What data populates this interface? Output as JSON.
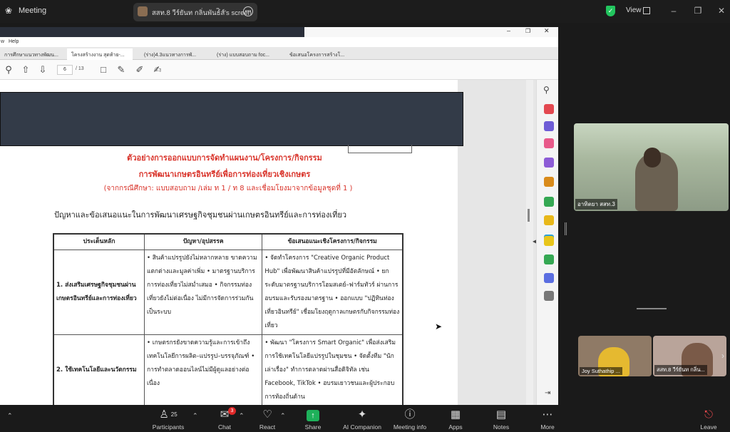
{
  "titlebar": {
    "app_name": "Meeting",
    "share_tab": "สสท.8 วีร์ยันท กลิ่นพันธ์ิส์'s screen",
    "view_label": "View"
  },
  "document": {
    "menu_items": [
      "w",
      "Help"
    ],
    "tabs": [
      "การศึกษาแนวทางพัฒน...",
      "โครงสร้างงาน สุดท้าย-...",
      "(ร่าง)4.3แนวทางการพั...",
      "(ร่าง) แบบสอบถาม foc...",
      "ข้อเสนอโครงการสร้างโ..."
    ],
    "active_tab_index": 1,
    "page_current": "6",
    "page_total": "/ 13",
    "title_line1": "ตัวอย่างการออกแบบการจัดทำแผนงาน/โครงการ/กิจกรรม",
    "title_line2": "การพัฒนาเกษตรอินทรีย์เพื่อการท่องเที่ยวเชิงเกษตร",
    "title_line3": "(จากกรณีศึกษา: แบบสอบถาม /เล่ม ท 1 / ท 8 และเชื่อมโยงมาจากข้อมูลชุดที่ 1 )",
    "heading": "ปัญหาและข้อเสนอแนะในการพัฒนาเศรษฐกิจชุมชนผ่านเกษตรอินทรีย์และการท่องเที่ยว",
    "table": {
      "headers": [
        "ประเด็นหลัก",
        "ปัญหา/อุปสรรค",
        "ข้อเสนอแนะเชิงโครงการ/กิจกรรม"
      ],
      "rows": [
        {
          "topic": "1. ส่งเสริมเศรษฐกิจชุมชนผ่านเกษตรอินทรีย์และการท่องเที่ยว",
          "problems": "• สินค้าแปรรูปยังไม่หลากหลาย ขาดความแตกต่างและมูลค่าเพิ่ม • มาตรฐานบริการการท่องเที่ยวไม่สม่ำเสมอ • กิจกรรมท่องเที่ยวยังไม่ต่อเนื่อง ไม่มีการจัดการร่วมกันเป็นระบบ",
          "proposals": "• จัดทำโครงการ \"Creative Organic Product Hub\" เพื่อพัฒนาสินค้าแปรรูปที่มีอัตลักษณ์ • ยกระดับมาตรฐานบริการโฮมสเตย์–ฟาร์มทัวร์ ผ่านการอบรมและรับรองมาตรฐาน • ออกแบบ \"ปฏิทินท่องเที่ยวอินทรีย์\" เชื่อมโยงฤดูกาลเกษตรกับกิจกรรมท่องเที่ยว"
        },
        {
          "topic": "2. ใช้เทคโนโลยีและนวัตกรรม",
          "problems": "• เกษตรกรยังขาดความรู้และการเข้าถึงเทคโนโลยีการผลิต–แปรรูป–บรรจุภัณฑ์ • การทำตลาดออนไลน์ไม่มีผู้ดูแลอย่างต่อเนื่อง",
          "proposals": "• พัฒนา \"โครงการ Smart Organic\" เพื่อส่งเสริมการใช้เทคโนโลยีแปรรูปในชุมชน • จัดตั้งทีม \"นักเล่าเรื่อง\" ทำการตลาดผ่านสื่อดิจิทัล เช่น Facebook, TikTok • อบรมเยาวชนและผู้ประกอบการท้องถิ่นด้าน"
        }
      ]
    }
  },
  "participants_video": [
    {
      "name": "อาทิตยา สสท.3"
    },
    {
      "name": "Joy Suthathip ..."
    },
    {
      "name": "สสท.8 วีร์ยันท กลิ่น..."
    }
  ],
  "bottom_bar": {
    "participants_label": "Participants",
    "participants_count": "25",
    "chat_label": "Chat",
    "chat_badge": "3",
    "react_label": "React",
    "share_label": "Share",
    "ai_label": "AI Companion",
    "meeting_info_label": "Meeting info",
    "apps_label": "Apps",
    "notes_label": "Notes",
    "more_label": "More",
    "leave_label": "Leave"
  },
  "colors": {
    "share_green": "#1eb15a",
    "doc_red": "#d9342b",
    "shield_green": "#22c55e"
  }
}
